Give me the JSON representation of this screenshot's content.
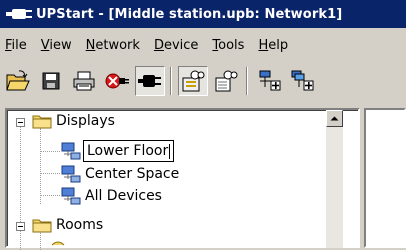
{
  "window": {
    "title": "UPStart - [Middle station.upb: Network1]"
  },
  "menu": [
    "File",
    "View",
    "Network",
    "Device",
    "Tools",
    "Help"
  ],
  "toolbar": {
    "buttons": [
      "open-folder-icon",
      "save-disk-icon",
      "print-icon",
      "disconnect-plug-icon",
      "connect-plug-icon",
      "glasses-view-icon",
      "glasses-doc-icon",
      "add-device-icon",
      "add-link-icon"
    ],
    "pressed": "connect-plug-icon"
  },
  "tree": {
    "nodes": [
      {
        "label": "Displays",
        "icon": "folder-icon",
        "expanded": true
      },
      {
        "label": "Lower Floor",
        "icon": "display-icon",
        "editing": true
      },
      {
        "label": "Center Space",
        "icon": "display-icon"
      },
      {
        "label": "All Devices",
        "icon": "display-icon"
      },
      {
        "label": "Rooms",
        "icon": "folder-icon",
        "expanded": true
      }
    ]
  },
  "colors": {
    "title_bar": "#0a246a",
    "face": "#d4d0c8",
    "folder": "#f5d66a"
  }
}
